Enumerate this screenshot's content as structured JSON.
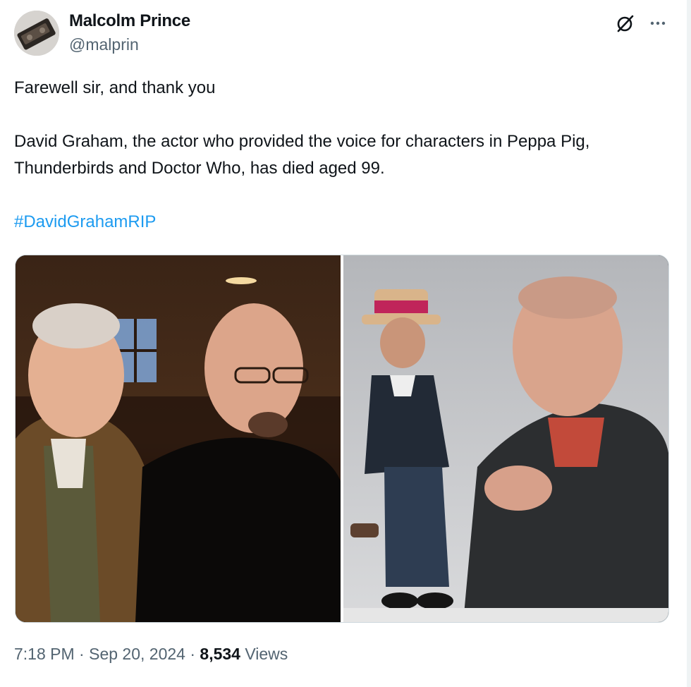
{
  "author": {
    "display_name": "Malcolm Prince",
    "handle": "@malprin",
    "avatar_icon": "avatar-photo"
  },
  "actions": {
    "grok_icon": "grok-icon",
    "more_icon": "more-options-icon"
  },
  "tweet": {
    "line1": "Farewell sir, and thank you",
    "line2": "David Graham, the actor who provided the voice for characters in Peppa Pig, Thunderbirds and Doctor Who, has died aged 99.",
    "hashtag": "#DavidGrahamRIP"
  },
  "meta": {
    "time": "7:18 PM",
    "separator": "·",
    "date": "Sep 20, 2024",
    "views_count": "8,534",
    "views_label": "Views"
  },
  "colors": {
    "link": "#1d9bf0",
    "text_primary": "#0f1419",
    "text_secondary": "#536471",
    "border": "#cfd9de"
  }
}
